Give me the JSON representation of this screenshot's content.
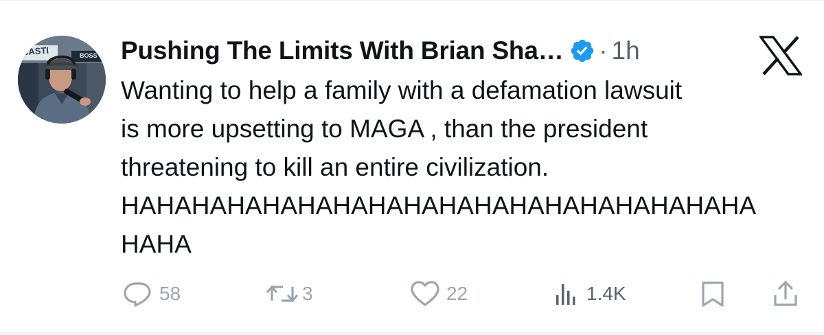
{
  "post": {
    "author": {
      "display_name": "Pushing The Limits With Brian Sha…",
      "verified": true,
      "avatar_badge_left": "CASTI",
      "avatar_badge_right": "BOSS"
    },
    "separator": "·",
    "time": "1h",
    "platform_icon": "x-logo-icon",
    "text_lines": [
      "Wanting to help a family with a defamation lawsuit",
      "is more upsetting to MAGA , than the president",
      "threatening to kill an entire civilization.",
      "HAHAHAHAHAHAHAHAHAHAHAHAHAHAHAHAHAHA",
      "HAHA"
    ],
    "actions": {
      "replies": "58",
      "reposts": "3",
      "likes": "22",
      "views": "1.4K"
    }
  },
  "colors": {
    "text": "#0f1419",
    "muted": "#536471",
    "action_muted": "#9aa6b0",
    "verified_blue": "#1d9bf0",
    "border": "#eff3f4"
  }
}
